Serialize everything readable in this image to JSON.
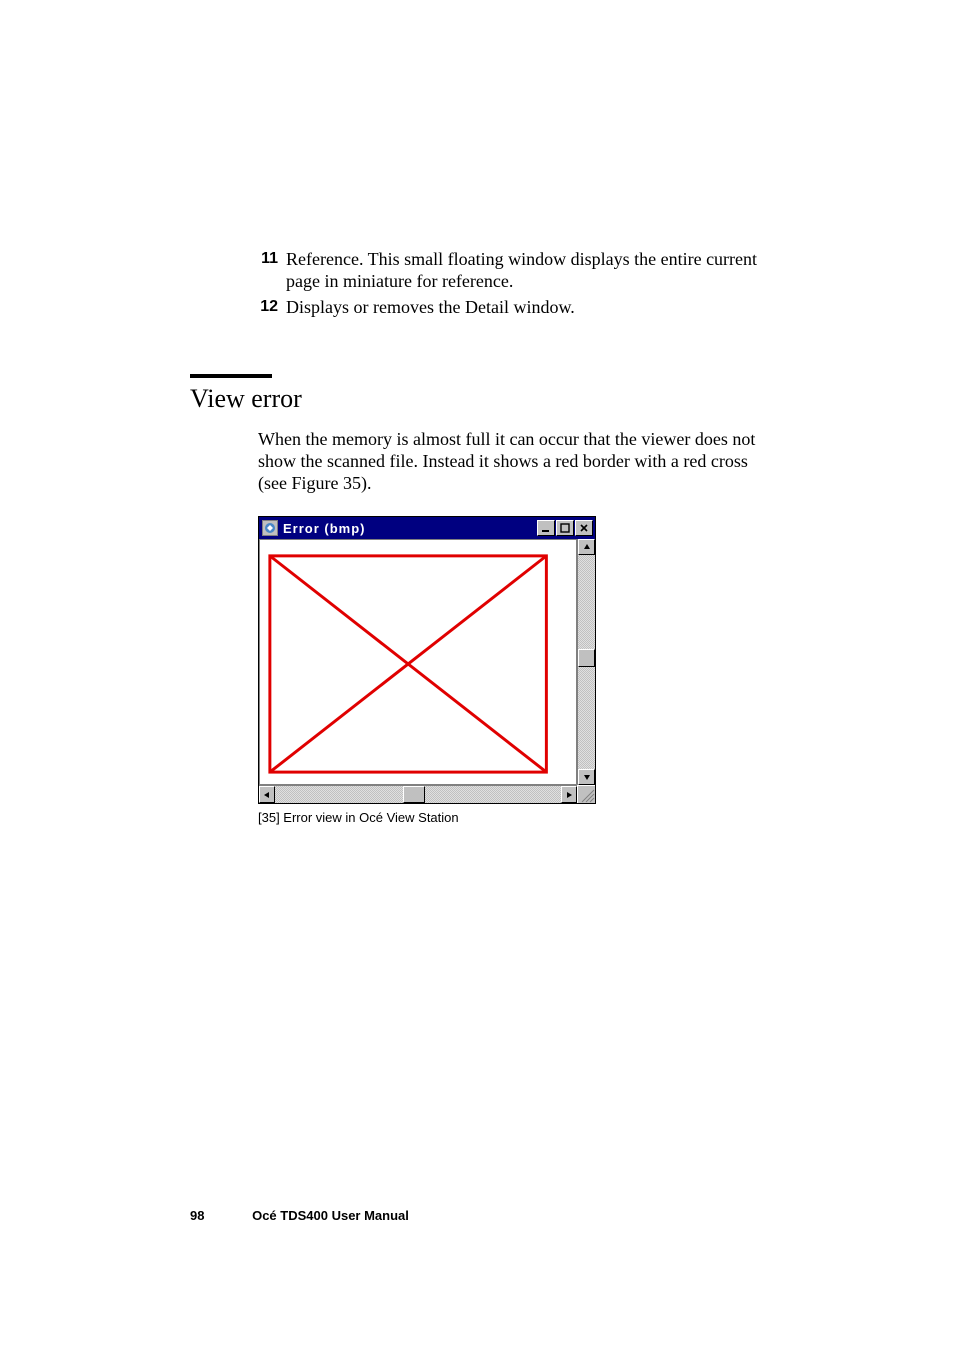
{
  "list": [
    {
      "num": "11",
      "text": "Reference. This small floating window displays the entire current page in miniature for reference."
    },
    {
      "num": "12",
      "text": "Displays or removes the Detail window."
    }
  ],
  "section_heading": "View error",
  "body_para": "When the memory is almost full it can occur that the viewer does not show the scanned file. Instead it shows a red border with a red cross (see Figure 35).",
  "window_title": "Error (bmp)",
  "caption": "[35] Error view in Océ View Station",
  "footer": {
    "page": "98",
    "title": "Océ TDS400 User Manual"
  }
}
